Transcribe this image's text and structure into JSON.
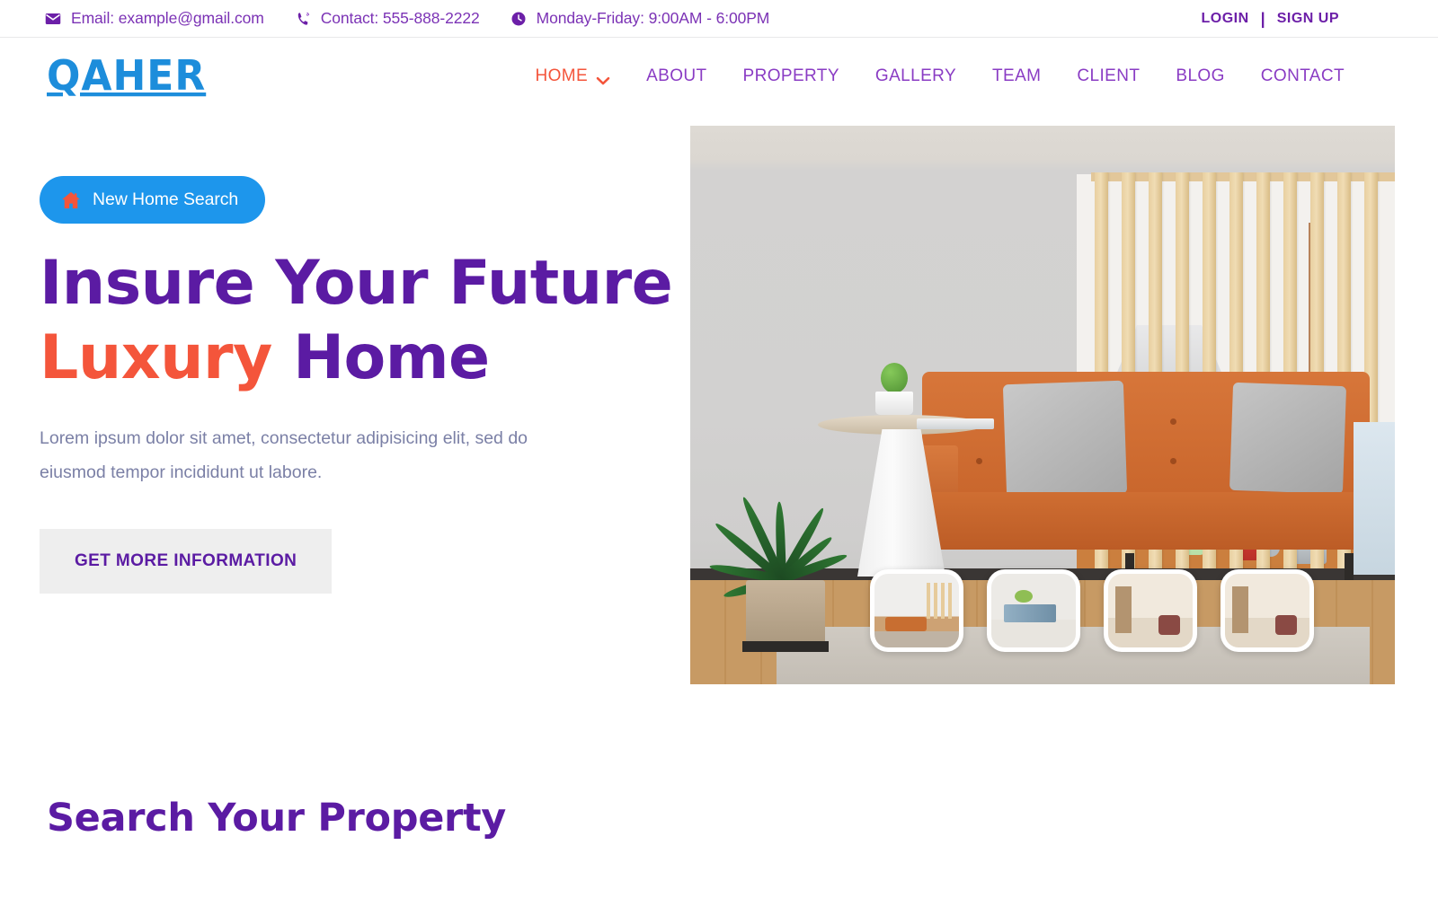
{
  "topbar": {
    "email": {
      "icon": "envelope-icon",
      "label": "Email: example@gmail.com"
    },
    "contact": {
      "icon": "phone-icon",
      "label": "Contact: 555-888-2222"
    },
    "hours": {
      "icon": "clock-icon",
      "label": "Monday-Friday: 9:00AM - 6:00PM"
    },
    "login_label": "LOGIN",
    "separator": "|",
    "signup_label": "SIGN UP"
  },
  "header": {
    "logo": "QAHER",
    "nav": [
      {
        "label": "HOME",
        "active": true,
        "has_dropdown": true
      },
      {
        "label": "ABOUT",
        "active": false,
        "has_dropdown": false
      },
      {
        "label": "PROPERTY",
        "active": false,
        "has_dropdown": false
      },
      {
        "label": "GALLERY",
        "active": false,
        "has_dropdown": false
      },
      {
        "label": "TEAM",
        "active": false,
        "has_dropdown": false
      },
      {
        "label": "CLIENT",
        "active": false,
        "has_dropdown": false
      },
      {
        "label": "BLOG",
        "active": false,
        "has_dropdown": false
      },
      {
        "label": "CONTACT",
        "active": false,
        "has_dropdown": false
      }
    ]
  },
  "hero": {
    "badge": {
      "icon": "home-icon",
      "label": "New Home Search"
    },
    "heading_line1": "Insure Your Future",
    "heading_line2_accent": "Luxury",
    "heading_line2_rest": "Home",
    "paragraph": "Lorem ipsum dolor sit amet, consectetur adipisicing elit, sed do eiusmod tempor incididunt ut labore.",
    "cta_label": "GET MORE INFORMATION",
    "image_alt": "Modern living room with orange leather sofa, palm plant, white side table and wooden slat divider in front of a kitchen",
    "thumbnails": [
      {
        "alt": "Living room with orange sofa and wooden slat screen"
      },
      {
        "alt": "Dining room with green centerpiece and blue chairs"
      },
      {
        "alt": "Hotel suite corridor with armchairs"
      },
      {
        "alt": "Hotel suite bedroom with armchairs"
      }
    ]
  },
  "search_section": {
    "title": "Search Your Property"
  },
  "colors": {
    "purple": "#6c1fa8",
    "purple_light": "#8a3cc4",
    "accent_orange": "#f4553b",
    "logo_blue": "#1d8ddb",
    "badge_blue": "#1d96ec",
    "cta_bg": "#eeeeee",
    "body_text": "#7b80a6"
  }
}
